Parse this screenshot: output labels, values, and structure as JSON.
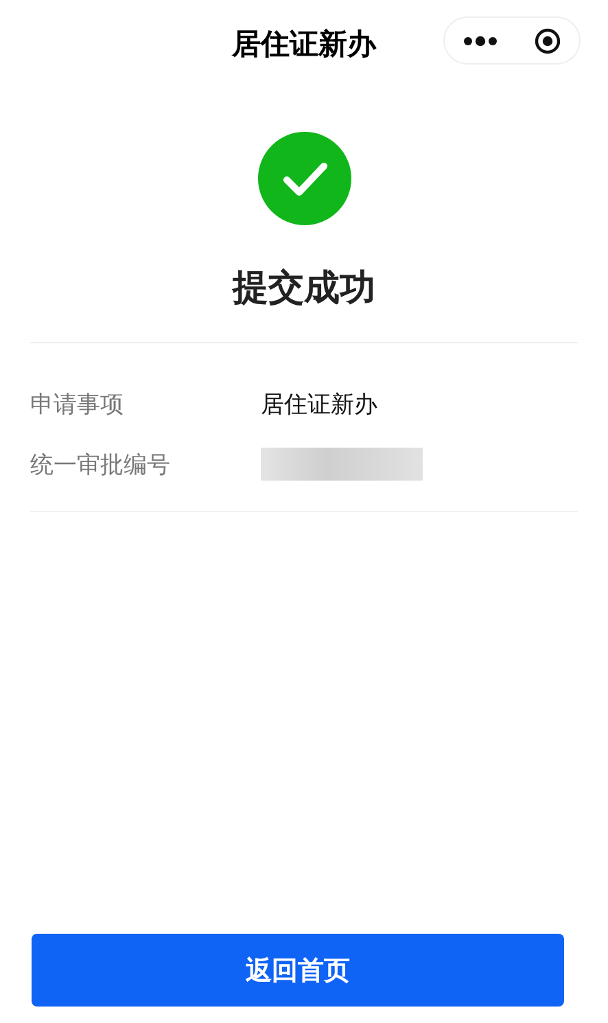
{
  "nav_bar": {
    "title": "居住证新办"
  },
  "result": {
    "success": true,
    "title": "提交成功"
  },
  "details": [
    {
      "kind": "text",
      "label": "申请事项",
      "value": "居住证新办"
    },
    {
      "kind": "redacted",
      "label": "统一审批编号"
    }
  ],
  "button": {
    "label": "返回首页"
  }
}
